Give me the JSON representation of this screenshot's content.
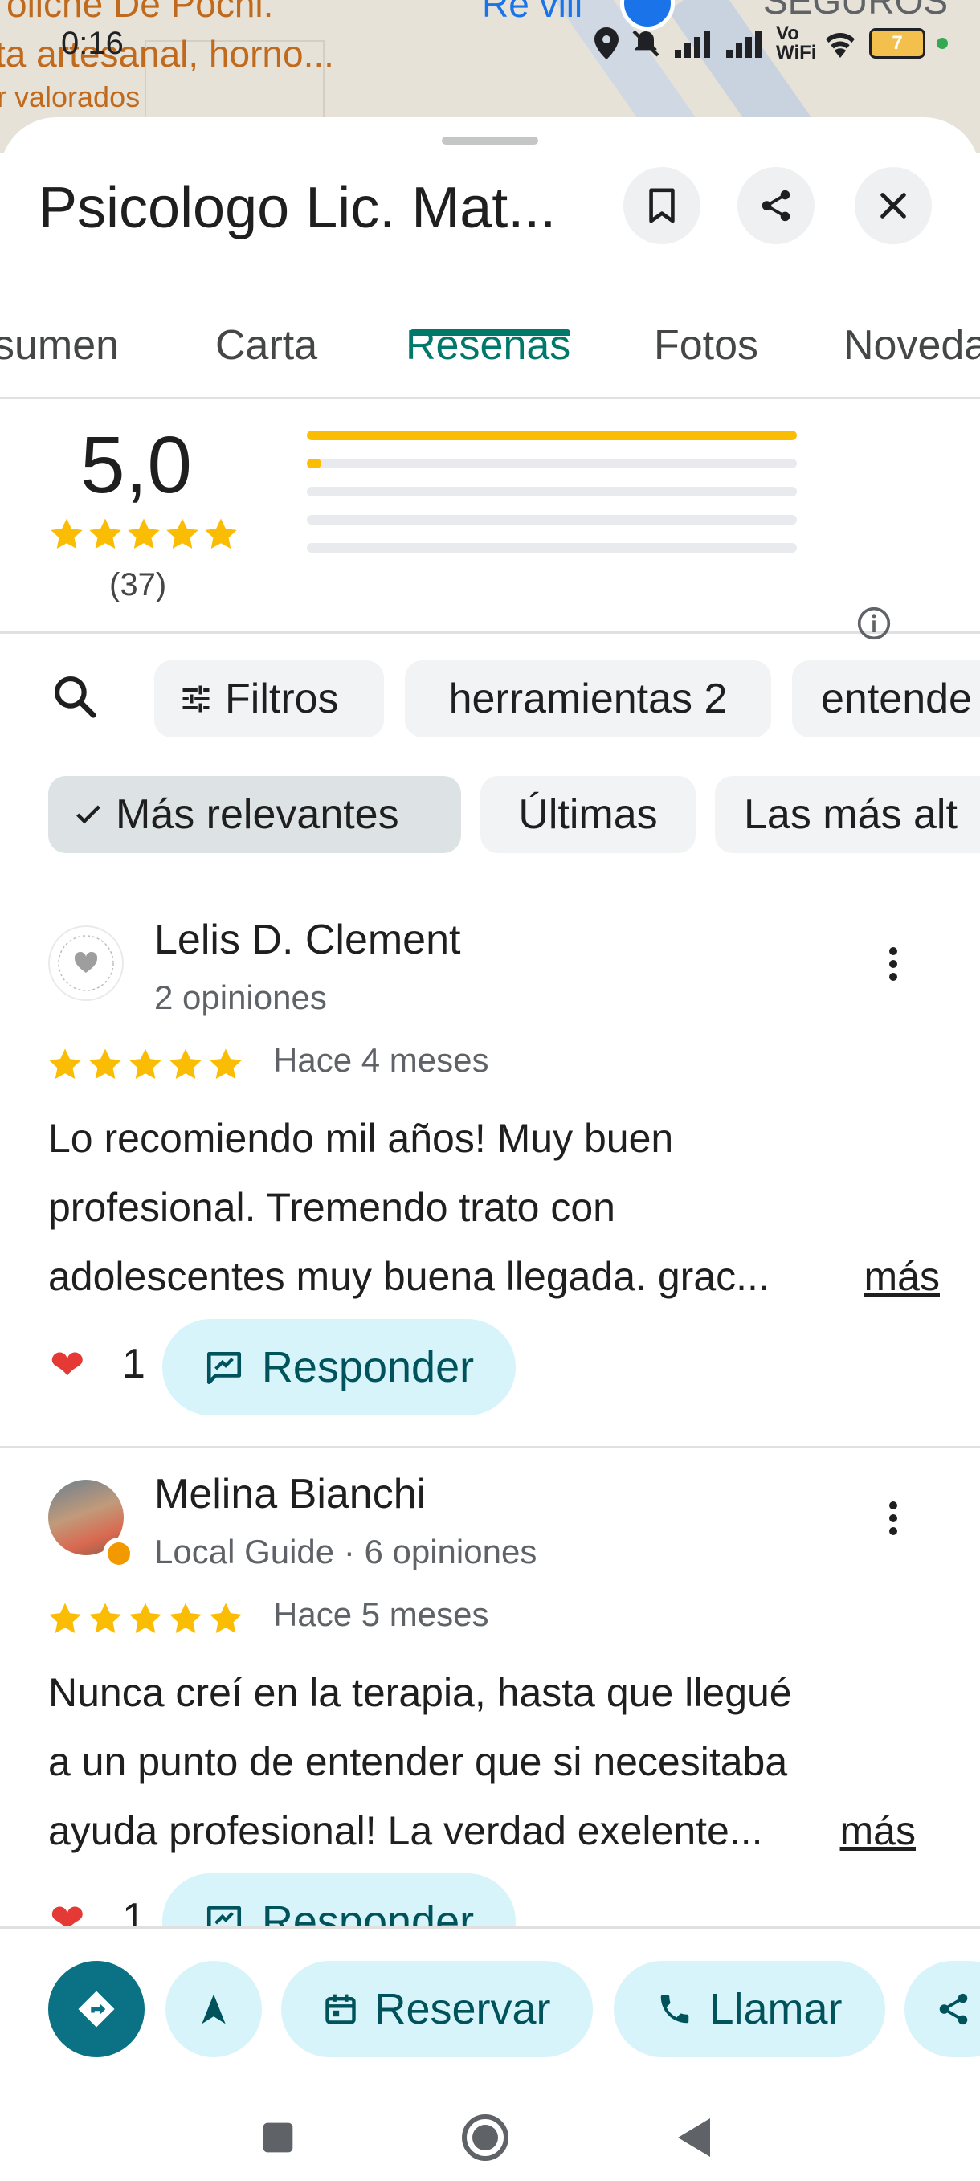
{
  "map": {
    "label_line1": "oliche De Pochi.",
    "label_line2": "ta artesanal, horno...",
    "label_line3": "r valorados",
    "label_blue": "Re viii",
    "label_grey": "SEGUROS"
  },
  "status_bar": {
    "time": "0:16",
    "network": "Vo WiFi",
    "battery": "7"
  },
  "header": {
    "title": "Psicologo Lic. Mat..."
  },
  "tabs": [
    {
      "label": "sumen"
    },
    {
      "label": "Carta"
    },
    {
      "label": "Reseñas",
      "active": true
    },
    {
      "label": "Fotos"
    },
    {
      "label": "Noveda"
    }
  ],
  "rating": {
    "score": "5,0",
    "count": "(37)",
    "distribution": [
      {
        "stars": 5,
        "fraction": 1.0
      },
      {
        "stars": 4,
        "fraction": 0.03
      },
      {
        "stars": 3,
        "fraction": 0.0
      },
      {
        "stars": 2,
        "fraction": 0.0
      },
      {
        "stars": 1,
        "fraction": 0.0
      }
    ]
  },
  "chips_topics": [
    {
      "label": "Filtros"
    },
    {
      "label": "herramientas 2"
    },
    {
      "label": "entende"
    }
  ],
  "chips_sort": [
    {
      "label": "Más relevantes",
      "selected": true
    },
    {
      "label": "Últimas"
    },
    {
      "label": "Las más alt"
    }
  ],
  "reviews": [
    {
      "name": "Lelis D. Clement",
      "meta": "2 opiniones",
      "stars": 5,
      "date": "Hace 4 meses",
      "text_lines": [
        "Lo recomiendo mil años! Muy buen",
        "profesional. Tremendo trato con",
        "adolescentes muy buena llegada. grac..."
      ],
      "more": "más",
      "likes": "1",
      "reply": "Responder"
    },
    {
      "name": "Melina Bianchi",
      "meta": "Local Guide · 6 opiniones",
      "stars": 5,
      "date": "Hace 5 meses",
      "text_lines": [
        "Nunca creí en la terapia, hasta que llegué",
        "a un punto de entender que si necesitaba",
        "ayuda profesional! La verdad exelente..."
      ],
      "more": "más",
      "likes": "1",
      "reply": "Responder"
    }
  ],
  "actions": {
    "reserve": "Reservar",
    "call": "Llamar"
  },
  "colors": {
    "accent": "#00796b",
    "star": "#fbbc04",
    "action_bg": "#d7f4fb",
    "action_text": "#00535b"
  }
}
